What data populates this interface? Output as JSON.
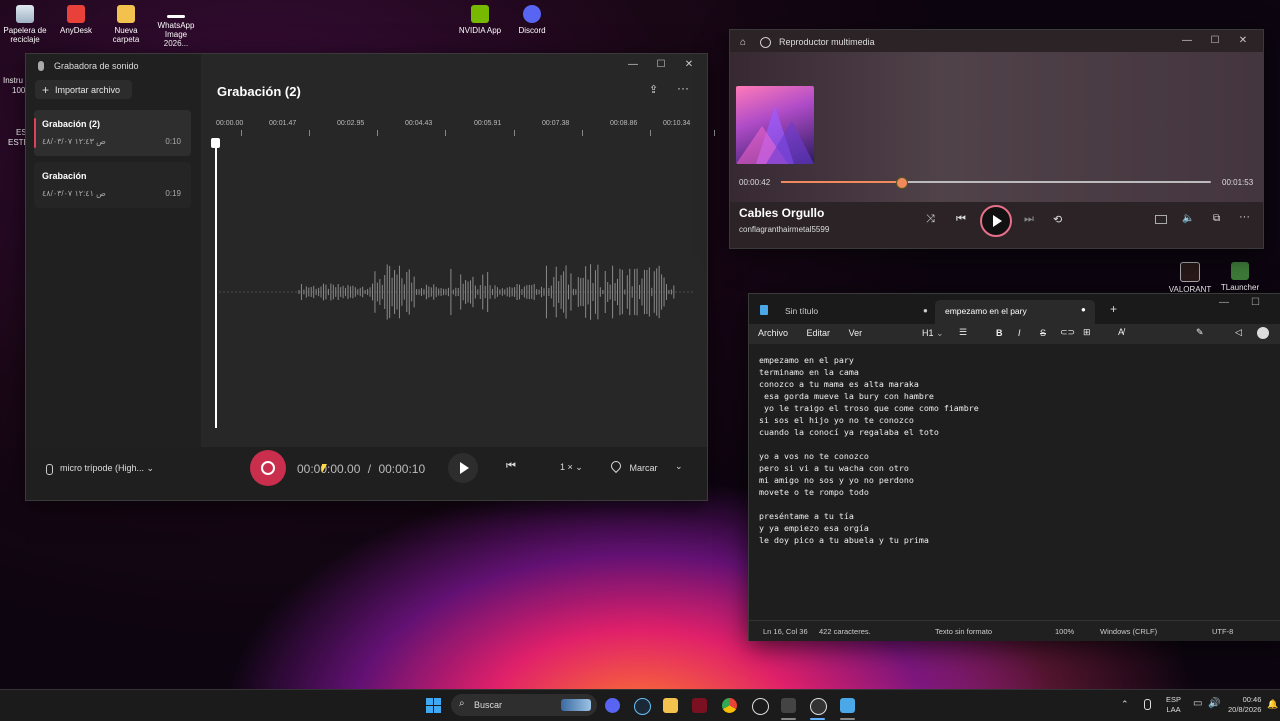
{
  "desktop": {
    "icons": [
      {
        "label": "Papelera de reciclaje",
        "icon": "recycle-bin-icon"
      },
      {
        "label": "AnyDesk",
        "icon": "anydesk-icon"
      },
      {
        "label": "Nueva carpeta",
        "icon": "folder-icon"
      },
      {
        "label": "WhatsApp Image 2026...",
        "icon": "image-file-icon"
      },
      {
        "label": "NVIDIA App",
        "icon": "nvidia-icon"
      },
      {
        "label": "Discord",
        "icon": "discord-icon"
      },
      {
        "label": "VALORANT",
        "icon": "valorant-icon"
      },
      {
        "label": "TLauncher",
        "icon": "tlauncher-icon"
      }
    ],
    "partial_left_labels": [
      "Instru",
      "100",
      "ES",
      "ESTE"
    ]
  },
  "recorder": {
    "app_title": "Grabadora de sonido",
    "import_label": "Importar archivo",
    "recordings": [
      {
        "title": "Grabación (2)",
        "date": "ص ١٢:٤٣ ٤٨/٠٣/٠٧",
        "duration": "0:10"
      },
      {
        "title": "Grabación",
        "date": "ص ١٢:٤١ ٤٨/٠٣/٠٧",
        "duration": "0:19"
      }
    ],
    "current_title": "Grabación (2)",
    "timeline_ticks": [
      "00:00.00",
      "00:01.47",
      "00:02.95",
      "00:04.43",
      "00:05.91",
      "00:07.38",
      "00:08.86",
      "00:10.34"
    ],
    "mic_label": "micro trípode (High...",
    "time_current": "00:00:00.00",
    "time_separator": "/",
    "time_total": "00:00:10",
    "speed_label": "1 ×",
    "mark_label": "Marcar"
  },
  "media": {
    "app_title": "Reproductor multimedia",
    "track_title": "Cables Orgullo",
    "artist": "conflagranthairmetal5599",
    "time_elapsed": "00:00:42",
    "time_total": "00:01:53",
    "progress_fraction": 0.28,
    "accent": "#f08a5d"
  },
  "notepad": {
    "tabs": [
      {
        "label": "Sin título"
      },
      {
        "label": "empezamo en el pary"
      }
    ],
    "menu": [
      "Archivo",
      "Editar",
      "Ver"
    ],
    "heading_label": "H1",
    "lines": [
      "empezamo en el pary",
      "terminamo en la cama",
      "conozco a tu mama es alta maraka",
      " esa gorda mueve la bury con hambre",
      " yo le traigo el troso que come como fiambre",
      "si sos el hijo yo no te conozco",
      "cuando la conocí ya regalaba el toto",
      "",
      "yo a vos no te conozco",
      "pero si vi a tu wacha con otro",
      "mi amigo no sos y yo no perdono",
      "movete o te rompo todo",
      "",
      "preséntame a tu tía",
      "y ya empiezo esa orgía",
      "le doy pico a tu abuela y tu prima"
    ],
    "status": {
      "position": "Ln 16, Col 36",
      "chars": "422 caracteres.",
      "format": "Texto sin formato",
      "zoom": "100%",
      "line_ending": "Windows (CRLF)",
      "encoding": "UTF-8"
    }
  },
  "taskbar": {
    "search_placeholder": "Buscar",
    "lang_top": "ESP",
    "lang_bottom": "LAA",
    "clock_time": "00:46",
    "clock_date": "20/8/2026"
  }
}
